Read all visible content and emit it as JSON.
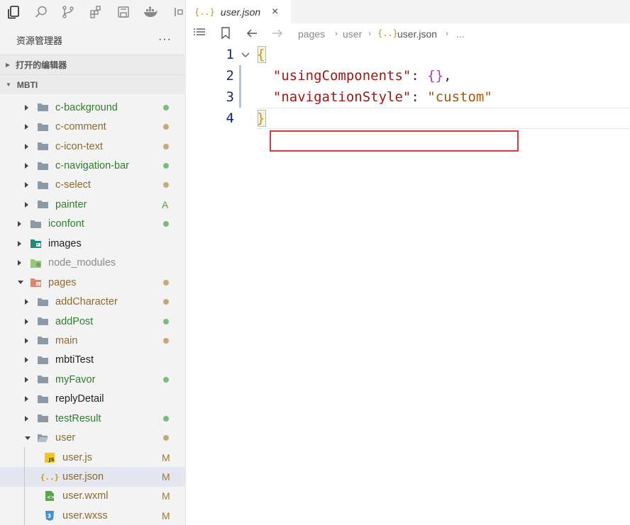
{
  "sidebar": {
    "title": "资源管理器",
    "more": "···",
    "sections": {
      "open_editors": "打开的编辑器",
      "project": "MBTI"
    },
    "tree": [
      {
        "name": "c-background",
        "type": "folder",
        "depth": 2,
        "expanded": false,
        "status": "dot",
        "color": "#2f7d2f",
        "dot": "#7dbb7a"
      },
      {
        "name": "c-comment",
        "type": "folder",
        "depth": 2,
        "expanded": false,
        "status": "dot",
        "color": "#8a6a2e",
        "dot": "#c8aa7a"
      },
      {
        "name": "c-icon-text",
        "type": "folder",
        "depth": 2,
        "expanded": false,
        "status": "dot",
        "color": "#8a6a2e",
        "dot": "#c8aa7a"
      },
      {
        "name": "c-navigation-bar",
        "type": "folder",
        "depth": 2,
        "expanded": false,
        "status": "dot",
        "color": "#2f7d2f",
        "dot": "#7dbb7a"
      },
      {
        "name": "c-select",
        "type": "folder",
        "depth": 2,
        "expanded": false,
        "status": "dot",
        "color": "#8a6a2e",
        "dot": "#c8aa7a"
      },
      {
        "name": "painter",
        "type": "folder",
        "depth": 2,
        "expanded": false,
        "status": "A",
        "color": "#2f7d2f",
        "dot": "#5a9a3a"
      },
      {
        "name": "iconfont",
        "type": "folder",
        "depth": 1,
        "expanded": false,
        "status": "dot",
        "color": "#2f7d2f",
        "dot": "#7dbb7a"
      },
      {
        "name": "images",
        "type": "images",
        "depth": 1,
        "expanded": false,
        "status": "",
        "color": "#222222",
        "dot": ""
      },
      {
        "name": "node_modules",
        "type": "node",
        "depth": 1,
        "expanded": false,
        "status": "",
        "color": "#8a8a8a",
        "dot": ""
      },
      {
        "name": "pages",
        "type": "pages",
        "depth": 1,
        "expanded": true,
        "status": "dot",
        "color": "#8a6a2e",
        "dot": "#c8aa7a"
      },
      {
        "name": "addCharacter",
        "type": "folder",
        "depth": 2,
        "expanded": false,
        "status": "dot",
        "color": "#8a6a2e",
        "dot": "#c8aa7a"
      },
      {
        "name": "addPost",
        "type": "folder",
        "depth": 2,
        "expanded": false,
        "status": "dot",
        "color": "#2f7d2f",
        "dot": "#7dbb7a"
      },
      {
        "name": "main",
        "type": "folder",
        "depth": 2,
        "expanded": false,
        "status": "dot",
        "color": "#8a6a2e",
        "dot": "#c8aa7a"
      },
      {
        "name": "mbtiTest",
        "type": "folder",
        "depth": 2,
        "expanded": false,
        "status": "",
        "color": "#222222",
        "dot": ""
      },
      {
        "name": "myFavor",
        "type": "folder",
        "depth": 2,
        "expanded": false,
        "status": "dot",
        "color": "#2f7d2f",
        "dot": "#7dbb7a"
      },
      {
        "name": "replyDetail",
        "type": "folder",
        "depth": 2,
        "expanded": false,
        "status": "",
        "color": "#222222",
        "dot": ""
      },
      {
        "name": "testResult",
        "type": "folder",
        "depth": 2,
        "expanded": false,
        "status": "dot",
        "color": "#2f7d2f",
        "dot": "#7dbb7a"
      },
      {
        "name": "user",
        "type": "folder-open",
        "depth": 2,
        "expanded": true,
        "status": "dot",
        "color": "#8a6a2e",
        "dot": "#c8aa7a"
      },
      {
        "name": "user.js",
        "type": "js",
        "depth": 3,
        "status": "M",
        "color": "#8a6a2e",
        "dot": "#a0782a"
      },
      {
        "name": "user.json",
        "type": "json",
        "depth": 3,
        "status": "M",
        "color": "#8a6a2e",
        "dot": "#a0782a",
        "selected": true
      },
      {
        "name": "user.wxml",
        "type": "wxml",
        "depth": 3,
        "status": "M",
        "color": "#8a6a2e",
        "dot": "#a0782a"
      },
      {
        "name": "user.wxss",
        "type": "wxss",
        "depth": 3,
        "status": "M",
        "color": "#8a6a2e",
        "dot": "#a0782a"
      }
    ]
  },
  "editor": {
    "tab": {
      "icon": "{..}",
      "label": "user.json",
      "close": "×"
    },
    "breadcrumb": [
      "pages",
      "user",
      "user.json",
      "..."
    ],
    "breadcrumb_icon": "{..}",
    "lines": [
      {
        "num": "1",
        "code": "{"
      },
      {
        "num": "2",
        "code": "  \"usingComponents\": {},"
      },
      {
        "num": "3",
        "code": "  \"navigationStyle\": \"custom\""
      },
      {
        "num": "4",
        "code": "}"
      }
    ]
  },
  "colors": {
    "accent": "#e0373b",
    "string_key": "#a31515",
    "string_value": "#a3560f",
    "modified": "#8a6a2e",
    "added": "#2f7d2f"
  }
}
